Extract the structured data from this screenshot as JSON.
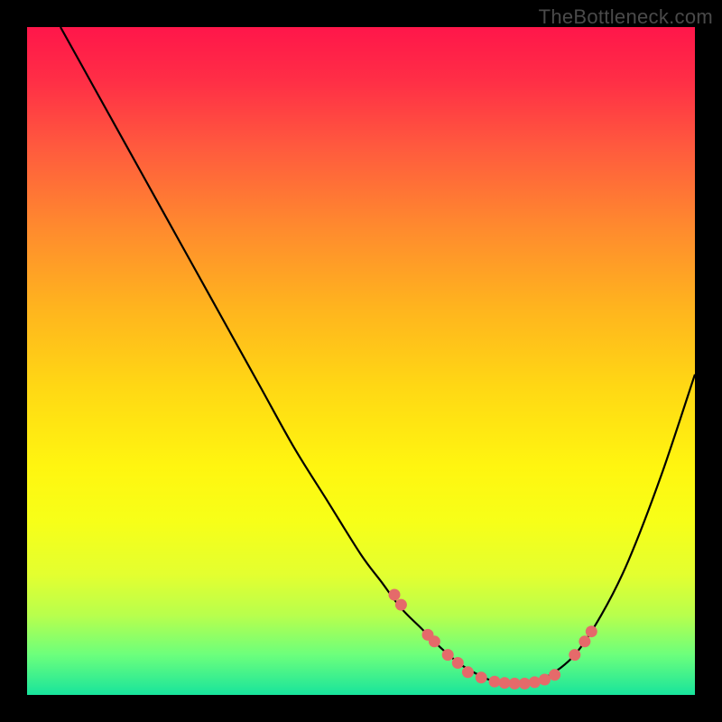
{
  "watermark": "TheBottleneck.com",
  "colors": {
    "curve": "#000000",
    "dot": "#e56a6a",
    "frame_bg_top": "#ff164a",
    "frame_bg_bottom": "#18e49c",
    "page_bg": "#000000"
  },
  "chart_data": {
    "type": "line",
    "title": "",
    "xlabel": "",
    "ylabel": "",
    "xlim": [
      0,
      100
    ],
    "ylim": [
      0,
      100
    ],
    "series": [
      {
        "name": "bottleneck-curve",
        "x": [
          5,
          10,
          15,
          20,
          25,
          30,
          35,
          40,
          45,
          50,
          53,
          56,
          59,
          62,
          65,
          68,
          70,
          72,
          75,
          78,
          82,
          86,
          90,
          95,
          100
        ],
        "y": [
          100,
          91,
          82,
          73,
          64,
          55,
          46,
          37,
          29,
          21,
          17,
          13,
          10,
          7,
          4.5,
          2.8,
          2.0,
          1.7,
          1.7,
          2.8,
          6,
          12,
          20,
          33,
          48
        ]
      }
    ],
    "scatter": [
      {
        "name": "highlighted-points",
        "points": [
          {
            "x": 55,
            "y": 15
          },
          {
            "x": 56,
            "y": 13.5
          },
          {
            "x": 60,
            "y": 9
          },
          {
            "x": 61,
            "y": 8
          },
          {
            "x": 63,
            "y": 6
          },
          {
            "x": 64.5,
            "y": 4.8
          },
          {
            "x": 66,
            "y": 3.4
          },
          {
            "x": 68,
            "y": 2.6
          },
          {
            "x": 70,
            "y": 2.0
          },
          {
            "x": 71.5,
            "y": 1.8
          },
          {
            "x": 73,
            "y": 1.7
          },
          {
            "x": 74.5,
            "y": 1.7
          },
          {
            "x": 76,
            "y": 1.9
          },
          {
            "x": 77.5,
            "y": 2.3
          },
          {
            "x": 79,
            "y": 3.0
          },
          {
            "x": 82,
            "y": 6
          },
          {
            "x": 83.5,
            "y": 8
          },
          {
            "x": 84.5,
            "y": 9.5
          }
        ]
      }
    ]
  }
}
